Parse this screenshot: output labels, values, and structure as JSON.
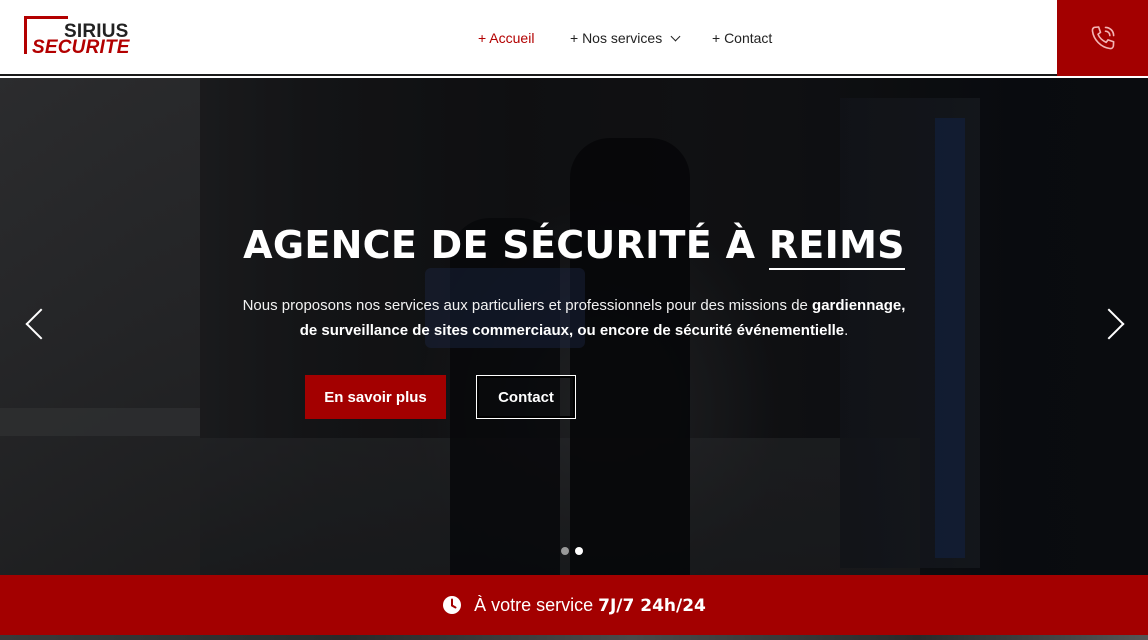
{
  "brand": {
    "line1": "SIRIUS",
    "line2": "SECURITE",
    "accent": "#a30000"
  },
  "nav": {
    "items": [
      {
        "label": "+ Accueil",
        "active": true
      },
      {
        "label": "+ Nos services",
        "dropdown": true
      },
      {
        "label": "+ Contact"
      }
    ]
  },
  "header": {
    "phone_icon": "phone-icon"
  },
  "hero": {
    "title_main": "AGENCE DE SÉCURITÉ À ",
    "title_city": "REIMS",
    "desc_1": "Nous proposons nos services aux particuliers et professionnels pour des missions de ",
    "desc_bold_1": "gardiennage,",
    "desc_bold_2": "de surveillance de sites commerciaux, ou encore de sécurité événementielle",
    "desc_end": ".",
    "btn_more": "En savoir plus",
    "btn_contact": "Contact",
    "slides": 2,
    "active_slide": 2
  },
  "band": {
    "text": "À votre service ",
    "highlight": "7J/7 24h/24",
    "icon": "clock-icon"
  }
}
